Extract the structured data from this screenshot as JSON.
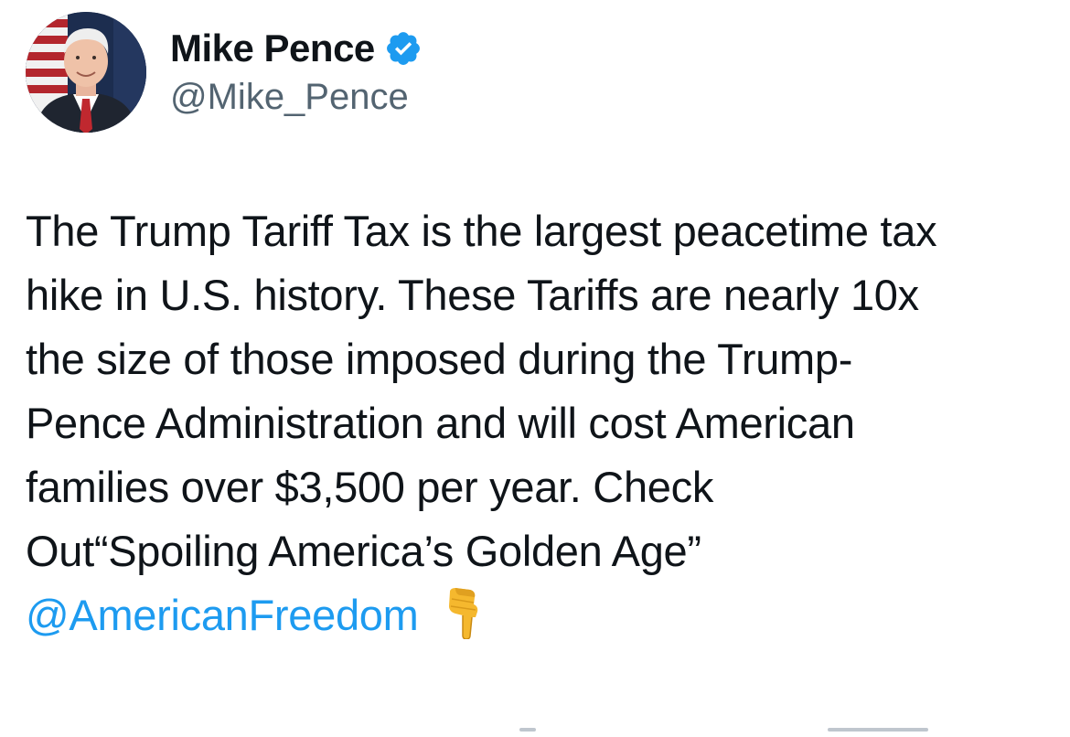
{
  "author": {
    "display_name": "Mike Pence",
    "handle": "@Mike_Pence",
    "verified": true,
    "avatar_icon": "profile-photo"
  },
  "tweet": {
    "lines": [
      "The Trump Tariff Tax is the largest peacetime tax",
      "hike in U.S. history. These Tariffs are nearly 10x",
      "the size of those imposed during the Trump-",
      "Pence Administration and will cost American",
      "families over $3,500 per year. Check",
      "Out“Spoiling America’s Golden Age”"
    ],
    "mention": "@AmericanFreedom",
    "emoji_icon": "backhand-index-pointing-down-icon"
  },
  "colors": {
    "text": "#0f1419",
    "secondary": "#536471",
    "link": "#1d9bf0",
    "verified": "#1d9bf0"
  }
}
